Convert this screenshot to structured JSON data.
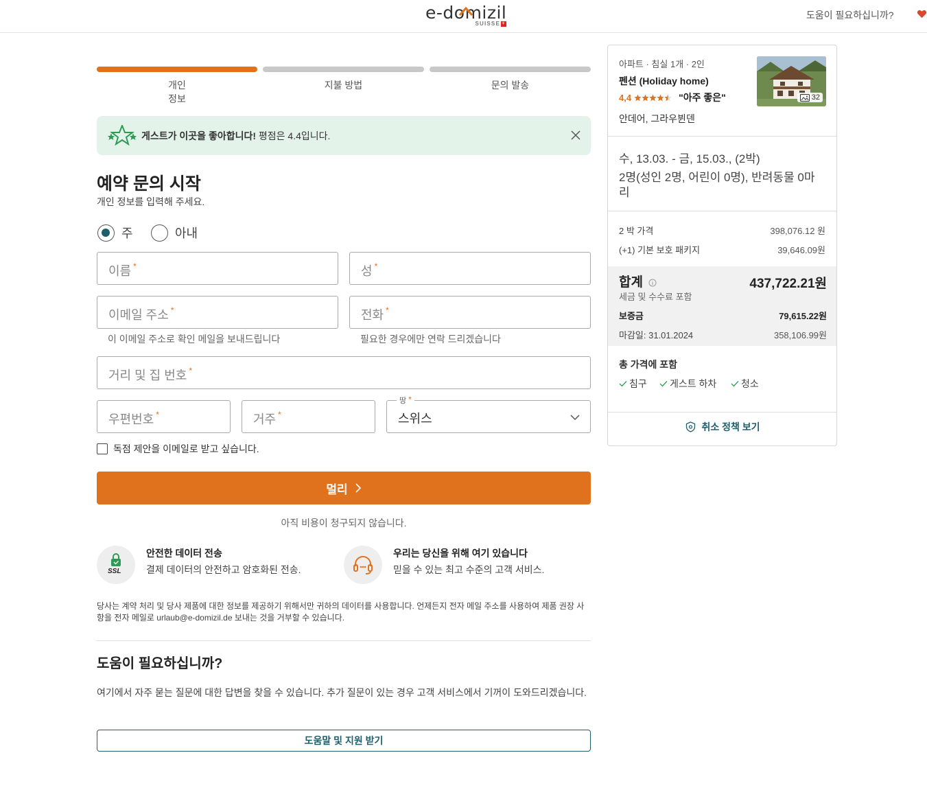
{
  "header": {
    "logo_text": "e-domizil",
    "logo_sub": "SUISSE",
    "help_link": "도움이 필요하십니까?"
  },
  "stepper": {
    "steps": [
      {
        "label_line1": "개인",
        "label_line2": "정보",
        "status": "active"
      },
      {
        "label_line1": "지불 방법",
        "label_line2": "",
        "status": "pending"
      },
      {
        "label_line1": "문의 발송",
        "label_line2": "",
        "status": "pending"
      }
    ]
  },
  "banner": {
    "bold_text": "게스트가 이곳을 좋아합니다!",
    "text": " 평점은 4.4입니다."
  },
  "form": {
    "title": "예약 문의 시작",
    "subtitle": "개인 정보를 입력해 주세요.",
    "salutation": {
      "options": [
        "주",
        "아내"
      ],
      "selected": "주"
    },
    "first_name_placeholder": "이름",
    "last_name_placeholder": "성",
    "email_placeholder": "이메일 주소",
    "email_hint": "이 이메일 주소로 확인 메일을 보내드립니다",
    "phone_placeholder": "전화",
    "phone_hint": "필요한 경우에만 연락 드리겠습니다",
    "street_placeholder": "거리 및 집 번호",
    "zip_placeholder": "우편번호",
    "city_placeholder": "거주",
    "country_label": "땅",
    "country_value": "스위스",
    "required_mark": "*",
    "newsletter_label": "독점 제안을 이메일로 받고 싶습니다.",
    "submit_label": "멀리",
    "no_charge_text": "아직 비용이 청구되지 않습니다."
  },
  "trust": {
    "ssl_title": "안전한 데이터 전송",
    "ssl_text": "결제 데이터의 안전하고 암호화된 전송.",
    "ssl_badge": "SSL",
    "support_title": "우리는 당신을 위해 여기 있습니다",
    "support_text": "믿을 수 있는 최고 수준의 고객 서비스."
  },
  "legal_text": "당사는 계약 처리 및 당사 제품에 대한 정보를 제공하기 위해서만 귀하의 데이터를 사용합니다. 언제든지 전자 메일 주소를 사용하여 제품 권장 사항을 전자 메일로 urlaub@e-domizil.de 보내는 것을 거부할 수 있습니다.",
  "help_section": {
    "title": "도움이 필요하십니까?",
    "text": "여기에서 자주 묻는 질문에 대한 답변을 찾을 수 있습니다. 추가 질문이 있는 경우 고객 서비스에서 기꺼이 도와드리겠습니다.",
    "button": "도움말 및 지원 받기"
  },
  "sidebar": {
    "meta": "아파트 · 침실 1개 · 2인",
    "name": "펜션 (Holiday home)",
    "rating": "4,4",
    "rating_stars": 4.5,
    "quote": "\"아주 좋은\"",
    "location": "안데어, 그라우뷘덴",
    "photo_count": "32",
    "dates": "수, 13.03. - 금, 15.03., (2박)",
    "guests": "2명(성인 2명, 어린이 0명), 반려동물 0마리",
    "price_label": "2 박 가격",
    "price_value": "398,076.12 원",
    "protection_label": "(+1) 기본 보호 패키지",
    "protection_value": "39,646.09원",
    "total_label": "합계",
    "total_value": "437,722.21원",
    "total_sub": "세금 및 수수료 포함",
    "deposit_label": "보증금",
    "deposit_value": "79,615.22원",
    "due_label": "마감일: 31.01.2024",
    "due_value": "358,106.99원",
    "included_title": "총 가격에 포함",
    "included": [
      "침구",
      "게스트 하차",
      "청소"
    ],
    "cancel_link": "취소 정책 보기"
  },
  "colors": {
    "accent_orange": "#e0721e",
    "teal": "#1e5e6b",
    "banner_green": "#e3f3ea",
    "star_green": "#2e9a55"
  }
}
